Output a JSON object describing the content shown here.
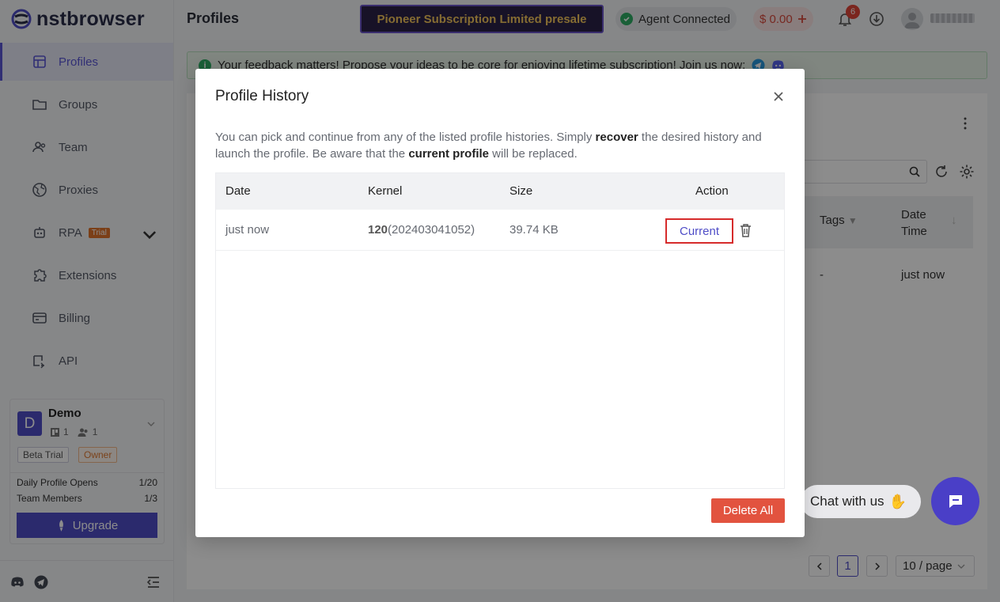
{
  "app": {
    "name": "nstbrowser",
    "page_title": "Profiles"
  },
  "sidebar": {
    "items": [
      {
        "label": "Profiles"
      },
      {
        "label": "Groups"
      },
      {
        "label": "Team"
      },
      {
        "label": "Proxies"
      },
      {
        "label": "RPA",
        "tag": "Trial"
      },
      {
        "label": "Extensions"
      },
      {
        "label": "Billing"
      },
      {
        "label": "API"
      }
    ],
    "team": {
      "avatar_letter": "D",
      "name": "Demo",
      "profiles_count": "1",
      "members_count": "1",
      "badge_plan": "Beta Trial",
      "badge_role": "Owner",
      "daily_opens_label": "Daily Profile Opens",
      "daily_opens_value": "1/20",
      "team_members_label": "Team Members",
      "team_members_value": "1/3",
      "upgrade_label": "Upgrade"
    }
  },
  "header": {
    "promo_label": "Pioneer Subscription Limited presale",
    "agent_status": "Agent Connected",
    "balance": "$ 0.00",
    "notification_count": "6"
  },
  "banner": {
    "text": "Your feedback matters! Propose your ideas to be core for enjoying lifetime subscription! Join us now:"
  },
  "background_table": {
    "col_tags": "Tags",
    "col_date": "Date Time",
    "row_tags": "-",
    "row_date": "just now",
    "pager_current": "1",
    "page_size": "10 / page"
  },
  "chat": {
    "label": "Chat with us"
  },
  "modal": {
    "title": "Profile History",
    "desc_part1": "You can pick and continue from any of the listed profile histories. Simply ",
    "desc_bold1": "recover",
    "desc_part2": " the desired history and launch the profile. Be aware that the ",
    "desc_bold2": "current profile",
    "desc_part3": " will be replaced.",
    "columns": [
      "Date",
      "Kernel",
      "Size",
      "Action"
    ],
    "rows": [
      {
        "date": "just now",
        "kernel_major": "120",
        "kernel_build": "(202403041052)",
        "size": "39.74 KB",
        "action": "Current"
      }
    ],
    "delete_all_label": "Delete All"
  },
  "colors": {
    "accent": "#4f4dc7",
    "danger": "#e2533f",
    "success": "#2fae64",
    "promo_bg": "#2a2248",
    "promo_text": "#f3c55c"
  }
}
